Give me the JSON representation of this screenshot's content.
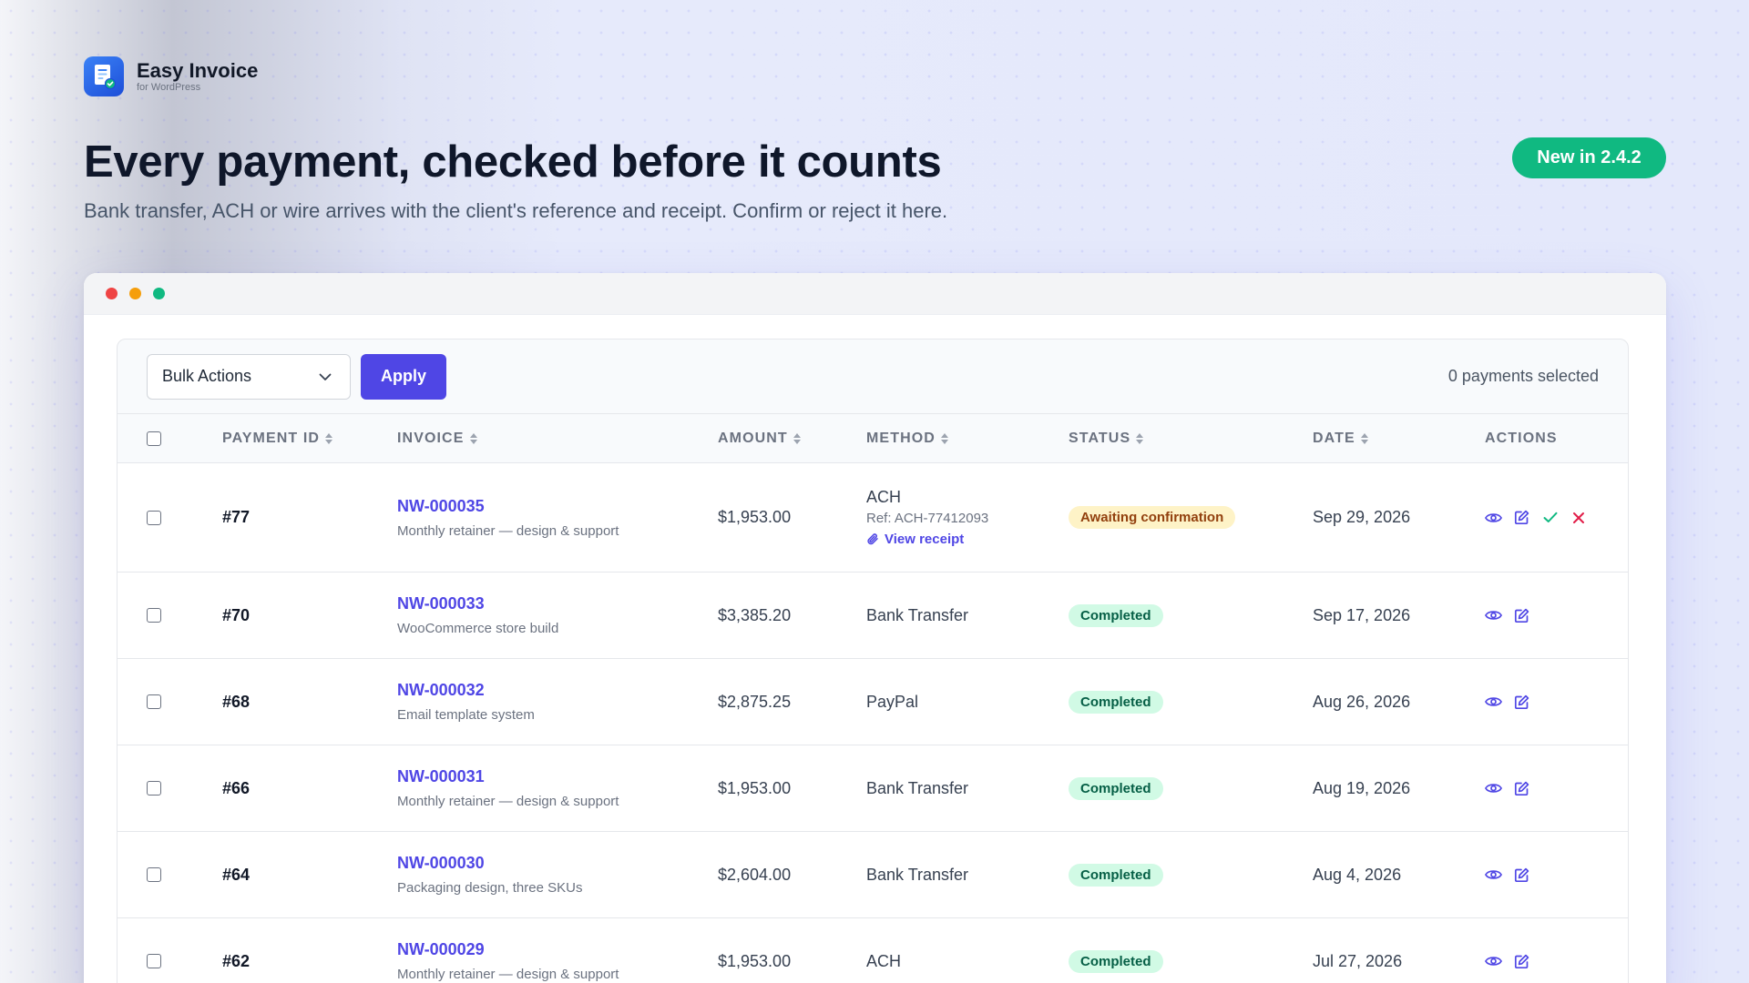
{
  "brand": {
    "name": "Easy Invoice",
    "tagline": "for WordPress"
  },
  "hero": {
    "headline": "Every payment, checked before it counts",
    "subheadline": "Bank transfer, ACH or wire arrives with the client's reference and receipt. Confirm or reject it here.",
    "badge": "New in 2.4.2"
  },
  "colors": {
    "accent": "#4f46e5",
    "badge_green": "#10b981",
    "window_dots": [
      "#ef4444",
      "#f59e0b",
      "#10b981"
    ],
    "awaiting_bg": "#fef3c7",
    "completed_bg": "#d1fae5"
  },
  "toolbar": {
    "bulk_select_value": "Bulk Actions",
    "apply_label": "Apply",
    "selected_count": "0 payments selected"
  },
  "table": {
    "headers": {
      "payment_id": "PAYMENT ID",
      "invoice": "INVOICE",
      "amount": "AMOUNT",
      "method": "METHOD",
      "status": "STATUS",
      "date": "DATE",
      "actions": "ACTIONS"
    },
    "rows": [
      {
        "id": "#77",
        "invoice": "NW-000035",
        "description": "Monthly retainer — design & support",
        "amount": "$1,953.00",
        "method": "ACH",
        "reference": "Ref: ACH-77412093",
        "receipt_label": "View receipt",
        "status": "Awaiting confirmation",
        "date": "Sep 29, 2026",
        "actions": [
          "eye-icon",
          "edit-icon",
          "check-icon",
          "x-icon"
        ]
      },
      {
        "id": "#70",
        "invoice": "NW-000033",
        "description": "WooCommerce store build",
        "amount": "$3,385.20",
        "method": "Bank Transfer",
        "status": "Completed",
        "date": "Sep 17, 2026",
        "actions": [
          "eye-icon",
          "edit-icon"
        ]
      },
      {
        "id": "#68",
        "invoice": "NW-000032",
        "description": "Email template system",
        "amount": "$2,875.25",
        "method": "PayPal",
        "status": "Completed",
        "date": "Aug 26, 2026",
        "actions": [
          "eye-icon",
          "edit-icon"
        ]
      },
      {
        "id": "#66",
        "invoice": "NW-000031",
        "description": "Monthly retainer — design & support",
        "amount": "$1,953.00",
        "method": "Bank Transfer",
        "status": "Completed",
        "date": "Aug 19, 2026",
        "actions": [
          "eye-icon",
          "edit-icon"
        ]
      },
      {
        "id": "#64",
        "invoice": "NW-000030",
        "description": "Packaging design, three SKUs",
        "amount": "$2,604.00",
        "method": "Bank Transfer",
        "status": "Completed",
        "date": "Aug 4, 2026",
        "actions": [
          "eye-icon",
          "edit-icon"
        ]
      },
      {
        "id": "#62",
        "invoice": "NW-000029",
        "description": "Monthly retainer — design & support",
        "amount": "$1,953.00",
        "method": "ACH",
        "status": "Completed",
        "date": "Jul 27, 2026",
        "actions": [
          "eye-icon",
          "edit-icon"
        ]
      }
    ]
  }
}
